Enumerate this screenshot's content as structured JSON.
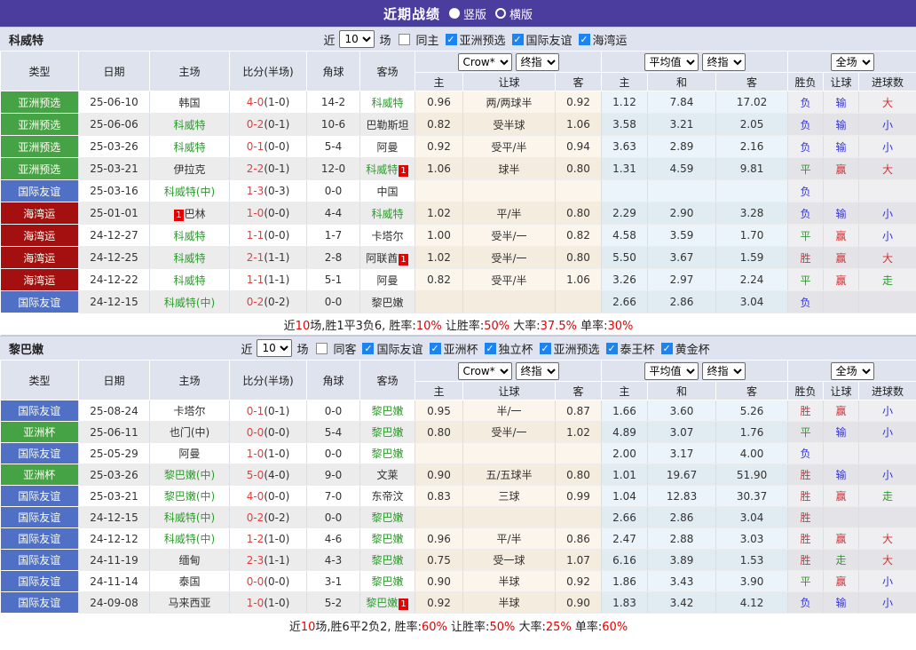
{
  "header": {
    "title": "近期战绩",
    "radios": [
      {
        "label": "竖版",
        "selected": true
      },
      {
        "label": "横版",
        "selected": false
      }
    ]
  },
  "table": {
    "columns": [
      "类型",
      "日期",
      "主场",
      "比分(半场)",
      "角球",
      "客场",
      "主",
      "让球",
      "客",
      "主",
      "和",
      "客",
      "胜负",
      "让球",
      "进球数"
    ],
    "dropdowns": {
      "odds_source": "Crow*",
      "odds_time": "终指",
      "avg_source": "平均值",
      "avg_time": "终指",
      "scope": "全场"
    },
    "type_colors": {
      "亚洲预选": "#45a345",
      "国际友谊": "#4f70c4",
      "海湾运": "#a40f0f",
      "亚洲杯": "#45a345"
    },
    "result_colors": {
      "red": "#d43030",
      "blue": "#3535d0",
      "green": "#2e9b2e"
    }
  },
  "sections": [
    {
      "team": "科威特",
      "filter": {
        "near": "近",
        "count": "10",
        "games": "场",
        "same": "同主",
        "same_checked": false,
        "competitions": [
          "亚洲预选",
          "国际友谊",
          "海湾运"
        ]
      },
      "rows": [
        {
          "type": "亚洲预选",
          "date": "25-06-10",
          "home": {
            "name": "韩国"
          },
          "score": "4-0",
          "half": "(1-0)",
          "corner": "14-2",
          "away": {
            "name": "科威特",
            "green": true
          },
          "odds": [
            "0.96",
            "两/两球半",
            "0.92"
          ],
          "avg": [
            "1.12",
            "7.84",
            "17.02"
          ],
          "results": [
            "负",
            "输",
            "大"
          ]
        },
        {
          "type": "亚洲预选",
          "date": "25-06-06",
          "home": {
            "name": "科威特",
            "green": true
          },
          "score": "0-2",
          "half": "(0-1)",
          "corner": "10-6",
          "away": {
            "name": "巴勒斯坦"
          },
          "odds": [
            "0.82",
            "受半球",
            "1.06"
          ],
          "avg": [
            "3.58",
            "3.21",
            "2.05"
          ],
          "results": [
            "负",
            "输",
            "小"
          ]
        },
        {
          "type": "亚洲预选",
          "date": "25-03-26",
          "home": {
            "name": "科威特",
            "green": true
          },
          "score": "0-1",
          "half": "(0-0)",
          "corner": "5-4",
          "away": {
            "name": "阿曼"
          },
          "odds": [
            "0.92",
            "受平/半",
            "0.94"
          ],
          "avg": [
            "3.63",
            "2.89",
            "2.16"
          ],
          "results": [
            "负",
            "输",
            "小"
          ]
        },
        {
          "type": "亚洲预选",
          "date": "25-03-21",
          "home": {
            "name": "伊拉克"
          },
          "score": "2-2",
          "half": "(0-1)",
          "corner": "12-0",
          "away": {
            "name": "科威特",
            "green": true,
            "badge": "1"
          },
          "odds": [
            "1.06",
            "球半",
            "0.80"
          ],
          "avg": [
            "1.31",
            "4.59",
            "9.81"
          ],
          "results": [
            "平",
            "赢",
            "大"
          ]
        },
        {
          "type": "国际友谊",
          "date": "25-03-16",
          "home": {
            "name": "科威特(中)",
            "green": true
          },
          "score": "1-3",
          "half": "(0-3)",
          "corner": "0-0",
          "away": {
            "name": "中国"
          },
          "odds": [
            "",
            "",
            ""
          ],
          "avg": [
            "",
            "",
            ""
          ],
          "results": [
            "负",
            "",
            ""
          ]
        },
        {
          "type": "海湾运",
          "date": "25-01-01",
          "home": {
            "name": "巴林",
            "badge": "1",
            "badge_before": true
          },
          "score": "1-0",
          "half": "(0-0)",
          "corner": "4-4",
          "away": {
            "name": "科威特",
            "green": true
          },
          "odds": [
            "1.02",
            "平/半",
            "0.80"
          ],
          "avg": [
            "2.29",
            "2.90",
            "3.28"
          ],
          "results": [
            "负",
            "输",
            "小"
          ]
        },
        {
          "type": "海湾运",
          "date": "24-12-27",
          "home": {
            "name": "科威特",
            "green": true
          },
          "score": "1-1",
          "half": "(0-0)",
          "corner": "1-7",
          "away": {
            "name": "卡塔尔"
          },
          "odds": [
            "1.00",
            "受半/一",
            "0.82"
          ],
          "avg": [
            "4.58",
            "3.59",
            "1.70"
          ],
          "results": [
            "平",
            "赢",
            "小"
          ]
        },
        {
          "type": "海湾运",
          "date": "24-12-25",
          "home": {
            "name": "科威特",
            "green": true
          },
          "score": "2-1",
          "half": "(1-1)",
          "corner": "2-8",
          "away": {
            "name": "阿联酋",
            "badge": "1"
          },
          "odds": [
            "1.02",
            "受半/一",
            "0.80"
          ],
          "avg": [
            "5.50",
            "3.67",
            "1.59"
          ],
          "results": [
            "胜",
            "赢",
            "大"
          ]
        },
        {
          "type": "海湾运",
          "date": "24-12-22",
          "home": {
            "name": "科威特",
            "green": true
          },
          "score": "1-1",
          "half": "(1-1)",
          "corner": "5-1",
          "away": {
            "name": "阿曼"
          },
          "odds": [
            "0.82",
            "受平/半",
            "1.06"
          ],
          "avg": [
            "3.26",
            "2.97",
            "2.24"
          ],
          "results": [
            "平",
            "赢",
            "走"
          ]
        },
        {
          "type": "国际友谊",
          "date": "24-12-15",
          "home": {
            "name": "科威特(中)",
            "green": true
          },
          "score": "0-2",
          "half": "(0-2)",
          "corner": "0-0",
          "away": {
            "name": "黎巴嫩"
          },
          "odds": [
            "",
            "",
            ""
          ],
          "avg": [
            "2.66",
            "2.86",
            "3.04"
          ],
          "results": [
            "负",
            "",
            ""
          ]
        }
      ],
      "summary": [
        {
          "text": "近"
        },
        {
          "text": "10",
          "red": true
        },
        {
          "text": "场,胜1平3负6, 胜率:"
        },
        {
          "text": "10%",
          "red": true
        },
        {
          "text": " 让胜率:"
        },
        {
          "text": "50%",
          "red": true
        },
        {
          "text": " 大率:"
        },
        {
          "text": "37.5%",
          "red": true
        },
        {
          "text": " 单率:"
        },
        {
          "text": "30%",
          "red": true
        }
      ]
    },
    {
      "team": "黎巴嫩",
      "filter": {
        "near": "近",
        "count": "10",
        "games": "场",
        "same": "同客",
        "same_checked": false,
        "competitions": [
          "国际友谊",
          "亚洲杯",
          "独立杯",
          "亚洲预选",
          "泰王杯",
          "黄金杯"
        ]
      },
      "rows": [
        {
          "type": "国际友谊",
          "date": "25-08-24",
          "home": {
            "name": "卡塔尔"
          },
          "score": "0-1",
          "half": "(0-1)",
          "corner": "0-0",
          "away": {
            "name": "黎巴嫩",
            "green": true
          },
          "odds": [
            "0.95",
            "半/一",
            "0.87"
          ],
          "avg": [
            "1.66",
            "3.60",
            "5.26"
          ],
          "results": [
            "胜",
            "赢",
            "小"
          ]
        },
        {
          "type": "亚洲杯",
          "date": "25-06-11",
          "home": {
            "name": "也门(中)"
          },
          "score": "0-0",
          "half": "(0-0)",
          "corner": "5-4",
          "away": {
            "name": "黎巴嫩",
            "green": true
          },
          "odds": [
            "0.80",
            "受半/一",
            "1.02"
          ],
          "avg": [
            "4.89",
            "3.07",
            "1.76"
          ],
          "results": [
            "平",
            "输",
            "小"
          ]
        },
        {
          "type": "国际友谊",
          "date": "25-05-29",
          "home": {
            "name": "阿曼"
          },
          "score": "1-0",
          "half": "(1-0)",
          "corner": "0-0",
          "away": {
            "name": "黎巴嫩",
            "green": true
          },
          "odds": [
            "",
            "",
            ""
          ],
          "avg": [
            "2.00",
            "3.17",
            "4.00"
          ],
          "results": [
            "负",
            "",
            ""
          ]
        },
        {
          "type": "亚洲杯",
          "date": "25-03-26",
          "home": {
            "name": "黎巴嫩(中)",
            "green": true
          },
          "score": "5-0",
          "half": "(4-0)",
          "corner": "9-0",
          "away": {
            "name": "文莱"
          },
          "odds": [
            "0.90",
            "五/五球半",
            "0.80"
          ],
          "avg": [
            "1.01",
            "19.67",
            "51.90"
          ],
          "results": [
            "胜",
            "输",
            "小"
          ]
        },
        {
          "type": "国际友谊",
          "date": "25-03-21",
          "home": {
            "name": "黎巴嫩(中)",
            "green": true
          },
          "score": "4-0",
          "half": "(0-0)",
          "corner": "7-0",
          "away": {
            "name": "东帝汶"
          },
          "odds": [
            "0.83",
            "三球",
            "0.99"
          ],
          "avg": [
            "1.04",
            "12.83",
            "30.37"
          ],
          "results": [
            "胜",
            "赢",
            "走"
          ]
        },
        {
          "type": "国际友谊",
          "date": "24-12-15",
          "home": {
            "name": "科威特(中)",
            "green": true
          },
          "score": "0-2",
          "half": "(0-2)",
          "corner": "0-0",
          "away": {
            "name": "黎巴嫩",
            "green": true
          },
          "odds": [
            "",
            "",
            ""
          ],
          "avg": [
            "2.66",
            "2.86",
            "3.04"
          ],
          "results": [
            "胜",
            "",
            ""
          ]
        },
        {
          "type": "国际友谊",
          "date": "24-12-12",
          "home": {
            "name": "科威特(中)",
            "green": true
          },
          "score": "1-2",
          "half": "(1-0)",
          "corner": "4-6",
          "away": {
            "name": "黎巴嫩",
            "green": true
          },
          "odds": [
            "0.96",
            "平/半",
            "0.86"
          ],
          "avg": [
            "2.47",
            "2.88",
            "3.03"
          ],
          "results": [
            "胜",
            "赢",
            "大"
          ]
        },
        {
          "type": "国际友谊",
          "date": "24-11-19",
          "home": {
            "name": "缅甸"
          },
          "score": "2-3",
          "half": "(1-1)",
          "corner": "4-3",
          "away": {
            "name": "黎巴嫩",
            "green": true
          },
          "odds": [
            "0.75",
            "受一球",
            "1.07"
          ],
          "avg": [
            "6.16",
            "3.89",
            "1.53"
          ],
          "results": [
            "胜",
            "走",
            "大"
          ]
        },
        {
          "type": "国际友谊",
          "date": "24-11-14",
          "home": {
            "name": "泰国"
          },
          "score": "0-0",
          "half": "(0-0)",
          "corner": "3-1",
          "away": {
            "name": "黎巴嫩",
            "green": true
          },
          "odds": [
            "0.90",
            "半球",
            "0.92"
          ],
          "avg": [
            "1.86",
            "3.43",
            "3.90"
          ],
          "results": [
            "平",
            "赢",
            "小"
          ]
        },
        {
          "type": "国际友谊",
          "date": "24-09-08",
          "home": {
            "name": "马来西亚"
          },
          "score": "1-0",
          "half": "(1-0)",
          "corner": "5-2",
          "away": {
            "name": "黎巴嫩",
            "green": true,
            "badge": "1"
          },
          "odds": [
            "0.92",
            "半球",
            "0.90"
          ],
          "avg": [
            "1.83",
            "3.42",
            "4.12"
          ],
          "results": [
            "负",
            "输",
            "小"
          ]
        }
      ],
      "summary": [
        {
          "text": "近"
        },
        {
          "text": "10",
          "red": true
        },
        {
          "text": "场,胜6平2负2, 胜率:"
        },
        {
          "text": "60%",
          "red": true
        },
        {
          "text": " 让胜率:"
        },
        {
          "text": "50%",
          "red": true
        },
        {
          "text": " 大率:"
        },
        {
          "text": "25%",
          "red": true
        },
        {
          "text": " 单率:"
        },
        {
          "text": "60%",
          "red": true
        }
      ]
    }
  ]
}
